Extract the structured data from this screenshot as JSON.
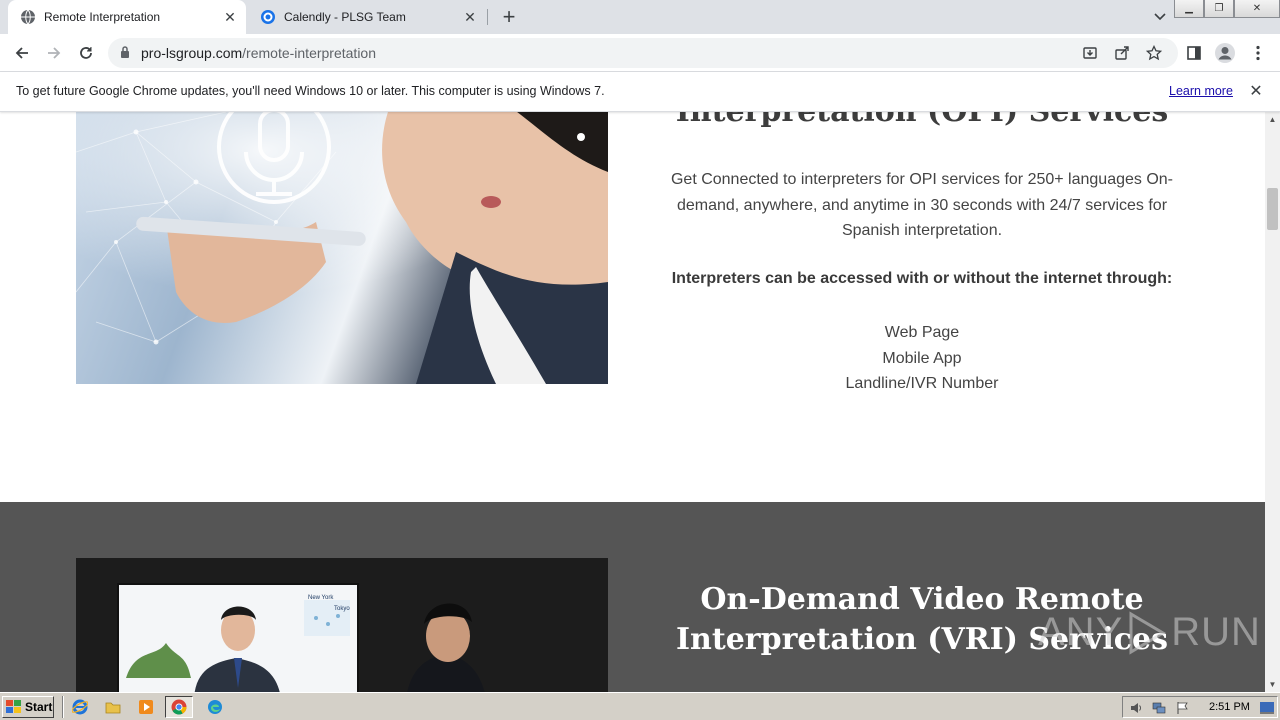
{
  "browser": {
    "tabs": [
      {
        "title": "Remote Interpretation",
        "favicon": "globe-icon",
        "active": true
      },
      {
        "title": "Calendly - PLSG Team",
        "favicon": "calendly-icon",
        "active": false
      }
    ],
    "url_host": "pro-lsgroup.com",
    "url_path": "/remote-interpretation"
  },
  "infobar": {
    "message": "To get future Google Chrome updates, you'll need Windows 10 or later. This computer is using Windows 7.",
    "link": "Learn more"
  },
  "page": {
    "opi_heading": "Interpretation (OPI) Services",
    "opi_paragraph": "Get Connected to interpreters for OPI services for 250+ languages On-demand, anywhere, and anytime in 30 seconds with 24/7 services for Spanish interpretation.",
    "access_heading": "Interpreters can be accessed with or without the internet through:",
    "access_methods": [
      "Web Page",
      "Mobile App",
      "Landline/IVR Number"
    ],
    "vri_heading_line1": "On-Demand Video Remote",
    "vri_heading_line2": "Interpretation (VRI) Services",
    "video_screen_labels": [
      "New York",
      "Tokyo"
    ],
    "watermark": "RUN",
    "watermark_prefix": "ANY"
  },
  "taskbar": {
    "start_label": "Start",
    "clock": "2:51 PM"
  },
  "colors": {
    "dark_section": "#555555",
    "link": "#1a0dab",
    "tabstrip": "#dee1e6"
  }
}
